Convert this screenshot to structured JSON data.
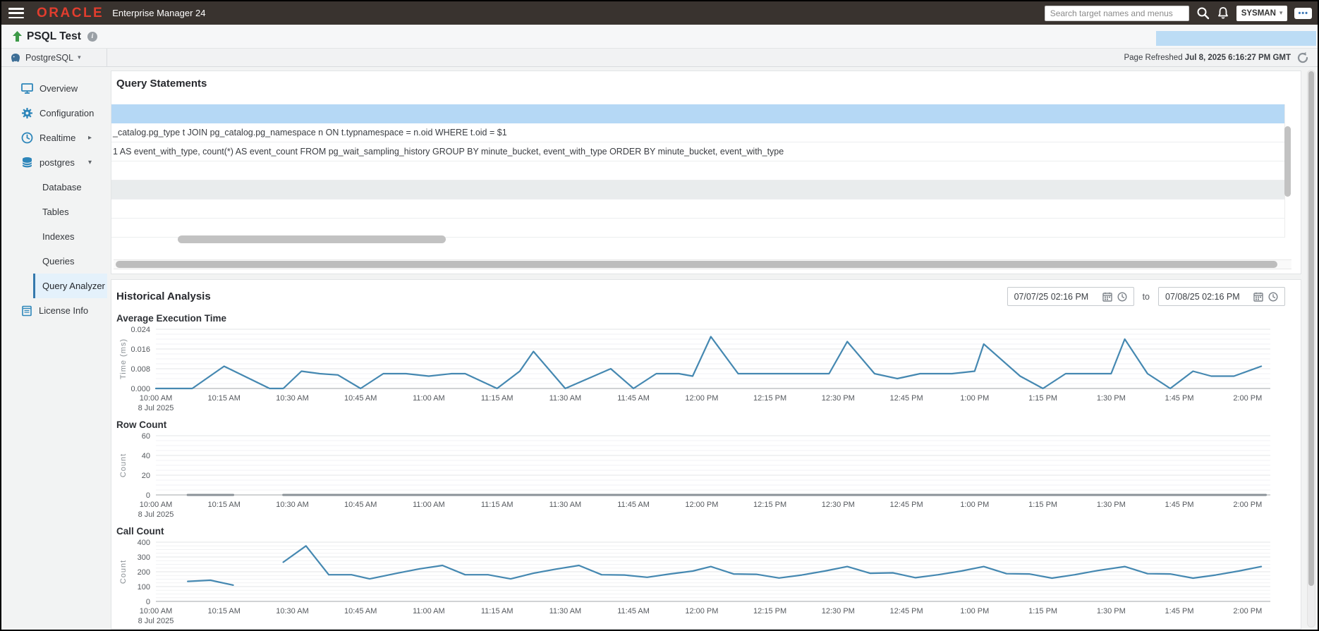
{
  "topbar": {
    "brand": "ORACLE",
    "product": "Enterprise Manager 24",
    "search_placeholder": "Search target names and menus",
    "user": "SYSMAN"
  },
  "header": {
    "title": "PSQL Test",
    "target_type": "PostgreSQL",
    "refresh_label": "Page Refreshed ",
    "refresh_time": "Jul 8, 2025 6:16:27 PM GMT"
  },
  "icons": {
    "chevron_right": "▸",
    "chevron_down": "▾",
    "dropdown_caret": "▾",
    "overflow_dots": "•••",
    "info": "i"
  },
  "sidebar": {
    "items": [
      {
        "label": "Overview",
        "icon": "monitor-icon"
      },
      {
        "label": "Configuration",
        "icon": "gear-icon"
      },
      {
        "label": "Realtime",
        "icon": "clock-icon",
        "expand": "right"
      },
      {
        "label": "postgres",
        "icon": "database-icon",
        "expand": "down"
      },
      {
        "label": "Database",
        "indent": true
      },
      {
        "label": "Tables",
        "indent": true
      },
      {
        "label": "Indexes",
        "indent": true
      },
      {
        "label": "Queries",
        "indent": true
      },
      {
        "label": "Query Analyzer",
        "indent": true,
        "selected": true
      },
      {
        "label": "License Info",
        "icon": "document-icon"
      }
    ]
  },
  "query_statements": {
    "title": "Query Statements",
    "rows": [
      {
        "state": "selected",
        "text": ""
      },
      {
        "state": "normal",
        "text": "_catalog.pg_type t JOIN pg_catalog.pg_namespace n ON t.typnamespace = n.oid WHERE t.oid = $1"
      },
      {
        "state": "normal",
        "text": "1 AS event_with_type, count(*) AS event_count FROM pg_wait_sampling_history GROUP BY minute_bucket, event_with_type ORDER BY minute_bucket, event_with_type"
      },
      {
        "state": "normal",
        "text": ""
      },
      {
        "state": "striped",
        "text": ""
      },
      {
        "state": "normal",
        "text": ""
      },
      {
        "state": "normal",
        "text": ""
      }
    ]
  },
  "historical_analysis": {
    "title": "Historical Analysis",
    "date_from": "07/07/25 02:16 PM",
    "to_label": "to",
    "date_to": "07/08/25 02:16 PM"
  },
  "chart_data": [
    {
      "id": "average-execution-time",
      "type": "line",
      "title": "Average Execution Time",
      "ylabel": "Time (ms)",
      "xlim": [
        0,
        245
      ],
      "ylim": [
        0,
        0.024
      ],
      "yticks": [
        0,
        0.008,
        0.016,
        0.024
      ],
      "ytick_labels": [
        "0.000",
        "0.008",
        "0.016",
        "0.024"
      ],
      "minor_per_major": 4,
      "xticks": [
        0,
        15,
        30,
        45,
        60,
        75,
        90,
        105,
        120,
        135,
        150,
        165,
        180,
        195,
        210,
        225,
        240
      ],
      "xtick_labels": [
        "10:00 AM",
        "10:15 AM",
        "10:30 AM",
        "10:45 AM",
        "11:00 AM",
        "11:15 AM",
        "11:30 AM",
        "11:45 AM",
        "12:00 PM",
        "12:15 PM",
        "12:30 PM",
        "12:45 PM",
        "1:00 PM",
        "1:15 PM",
        "1:30 PM",
        "1:45 PM",
        "2:00 PM"
      ],
      "x_date_label": "8 Jul 2025",
      "x_unit": "minutes after 10:00 AM",
      "grid": true,
      "legend": "none",
      "series": [
        {
          "name": "Average Execution Time (ms)",
          "color": "#4588b1",
          "width": 2.2,
          "segments": [
            [
              [
                0,
                0
              ],
              [
                8,
                0
              ],
              [
                15,
                0.009
              ],
              [
                25,
                0
              ],
              [
                28,
                0
              ],
              [
                32,
                0.007
              ],
              [
                36,
                0.006
              ],
              [
                40,
                0.0055
              ],
              [
                45,
                0
              ],
              [
                50,
                0.006
              ],
              [
                55,
                0.006
              ],
              [
                60,
                0.005
              ],
              [
                65,
                0.006
              ],
              [
                68,
                0.006
              ],
              [
                75,
                0
              ],
              [
                80,
                0.007
              ],
              [
                83,
                0.015
              ],
              [
                90,
                0
              ],
              [
                100,
                0.008
              ],
              [
                105,
                0
              ],
              [
                110,
                0.006
              ],
              [
                115,
                0.006
              ],
              [
                118,
                0.005
              ],
              [
                122,
                0.021
              ],
              [
                128,
                0.006
              ],
              [
                148,
                0.006
              ],
              [
                152,
                0.019
              ],
              [
                158,
                0.006
              ],
              [
                163,
                0.004
              ],
              [
                168,
                0.006
              ],
              [
                175,
                0.006
              ],
              [
                180,
                0.007
              ],
              [
                182,
                0.018
              ],
              [
                190,
                0.005
              ],
              [
                195,
                0
              ],
              [
                200,
                0.006
              ],
              [
                210,
                0.006
              ],
              [
                213,
                0.02
              ],
              [
                218,
                0.006
              ],
              [
                223,
                0
              ],
              [
                228,
                0.007
              ],
              [
                232,
                0.005
              ],
              [
                237,
                0.005
              ],
              [
                243,
                0.009
              ]
            ]
          ]
        }
      ]
    },
    {
      "id": "row-count",
      "type": "line",
      "title": "Row Count",
      "ylabel": "Count",
      "xlim": [
        0,
        245
      ],
      "ylim": [
        0,
        60
      ],
      "yticks": [
        0,
        20,
        40,
        60
      ],
      "ytick_labels": [
        "0",
        "20",
        "40",
        "60"
      ],
      "minor_per_major": 4,
      "xticks": [
        0,
        15,
        30,
        45,
        60,
        75,
        90,
        105,
        120,
        135,
        150,
        165,
        180,
        195,
        210,
        225,
        240
      ],
      "xtick_labels": [
        "10:00 AM",
        "10:15 AM",
        "10:30 AM",
        "10:45 AM",
        "11:00 AM",
        "11:15 AM",
        "11:30 AM",
        "11:45 AM",
        "12:00 PM",
        "12:15 PM",
        "12:30 PM",
        "12:45 PM",
        "1:00 PM",
        "1:15 PM",
        "1:30 PM",
        "1:45 PM",
        "2:00 PM"
      ],
      "x_date_label": "8 Jul 2025",
      "x_unit": "minutes after 10:00 AM",
      "grid": true,
      "legend": "none",
      "series": [
        {
          "name": "Row Count",
          "color": "#8b9298",
          "width": 3,
          "segments": [
            [
              [
                7,
                0
              ],
              [
                17,
                0
              ]
            ],
            [
              [
                28,
                0
              ],
              [
                244,
                0
              ]
            ]
          ]
        }
      ]
    },
    {
      "id": "call-count",
      "type": "line",
      "title": "Call Count",
      "ylabel": "Count",
      "xlim": [
        0,
        245
      ],
      "ylim": [
        0,
        400
      ],
      "yticks": [
        0,
        100,
        200,
        300,
        400
      ],
      "ytick_labels": [
        "0",
        "100",
        "200",
        "300",
        "400"
      ],
      "minor_per_major": 4,
      "xticks": [
        0,
        15,
        30,
        45,
        60,
        75,
        90,
        105,
        120,
        135,
        150,
        165,
        180,
        195,
        210,
        225,
        240
      ],
      "xtick_labels": [
        "10:00 AM",
        "10:15 AM",
        "10:30 AM",
        "10:45 AM",
        "11:00 AM",
        "11:15 AM",
        "11:30 AM",
        "11:45 AM",
        "12:00 PM",
        "12:15 PM",
        "12:30 PM",
        "12:45 PM",
        "1:00 PM",
        "1:15 PM",
        "1:30 PM",
        "1:45 PM",
        "2:00 PM"
      ],
      "x_date_label": "8 Jul 2025",
      "x_unit": "minutes after 10:00 AM",
      "grid": true,
      "legend": "none",
      "series": [
        {
          "name": "Call Count",
          "color": "#4588b1",
          "width": 2.2,
          "segments": [
            [
              [
                7,
                135
              ],
              [
                12,
                143
              ],
              [
                17,
                110
              ]
            ],
            [
              [
                28,
                265
              ],
              [
                33,
                375
              ],
              [
                38,
                180
              ],
              [
                43,
                180
              ],
              [
                47,
                152
              ],
              [
                53,
                190
              ],
              [
                58,
                220
              ],
              [
                63,
                243
              ],
              [
                68,
                180
              ],
              [
                73,
                180
              ],
              [
                78,
                152
              ],
              [
                83,
                190
              ],
              [
                88,
                218
              ],
              [
                93,
                243
              ],
              [
                98,
                180
              ],
              [
                103,
                178
              ],
              [
                108,
                163
              ],
              [
                113,
                185
              ],
              [
                118,
                205
              ],
              [
                122,
                235
              ],
              [
                127,
                185
              ],
              [
                132,
                183
              ],
              [
                137,
                158
              ],
              [
                142,
                178
              ],
              [
                147,
                205
              ],
              [
                152,
                235
              ],
              [
                157,
                190
              ],
              [
                162,
                193
              ],
              [
                167,
                160
              ],
              [
                172,
                180
              ],
              [
                177,
                205
              ],
              [
                182,
                235
              ],
              [
                187,
                187
              ],
              [
                192,
                185
              ],
              [
                197,
                157
              ],
              [
                202,
                180
              ],
              [
                207,
                208
              ],
              [
                213,
                235
              ],
              [
                218,
                187
              ],
              [
                223,
                185
              ],
              [
                228,
                157
              ],
              [
                233,
                178
              ],
              [
                238,
                205
              ],
              [
                243,
                235
              ]
            ]
          ]
        }
      ]
    }
  ]
}
